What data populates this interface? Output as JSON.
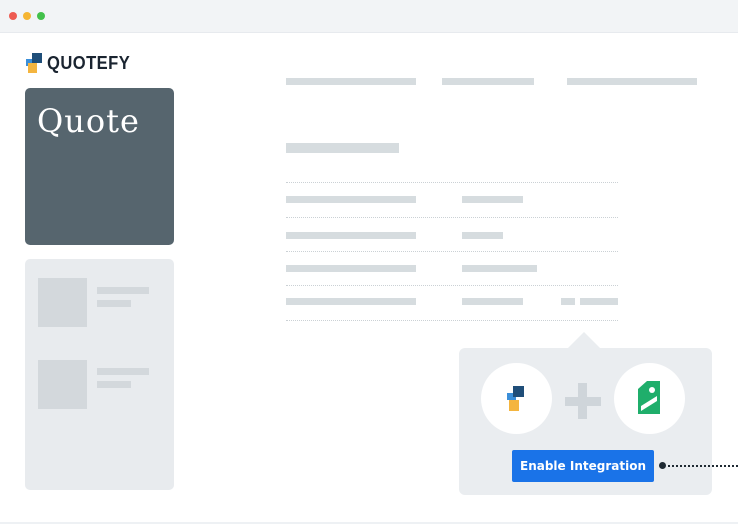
{
  "window": {
    "controls": [
      "close",
      "minimize",
      "maximize"
    ]
  },
  "brand": {
    "name": "QUOTEFY",
    "icon": "quotefy-logo-icon"
  },
  "sidebar": {
    "active_card_label": "Quote",
    "placeholder_items": 2
  },
  "integration": {
    "left_app_icon": "quotefy-logo-icon",
    "join_icon": "plus-icon",
    "right_app_icon": "price-tag-icon",
    "button_label": "Enable Integration",
    "accent_color": "#1a73e8",
    "partner_color": "#1fae6b"
  }
}
